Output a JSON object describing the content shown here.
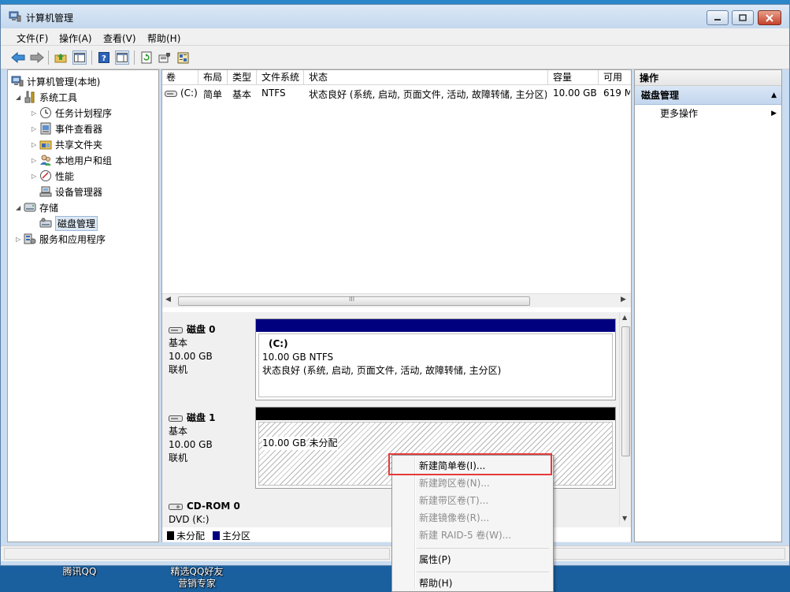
{
  "window": {
    "title": "计算机管理",
    "minimize_glyph": "",
    "close_glyph": "✕"
  },
  "menu": [
    "文件(F)",
    "操作(A)",
    "查看(V)",
    "帮助(H)"
  ],
  "tree": {
    "root": "计算机管理(本地)",
    "system_tools": "系统工具",
    "task_scheduler": "任务计划程序",
    "event_viewer": "事件查看器",
    "shared_folders": "共享文件夹",
    "local_users": "本地用户和组",
    "performance": "性能",
    "device_manager": "设备管理器",
    "storage": "存储",
    "disk_management": "磁盘管理",
    "services_apps": "服务和应用程序"
  },
  "volume_table": {
    "columns": [
      "卷",
      "布局",
      "类型",
      "文件系统",
      "状态",
      "容量",
      "可用空"
    ],
    "rows": [
      [
        "(C:)",
        "简单",
        "基本",
        "NTFS",
        "状态良好 (系统, 启动, 页面文件, 活动, 故障转储, 主分区)",
        "10.00 GB",
        "619 M"
      ]
    ],
    "scroll_glyph": "III"
  },
  "disks": [
    {
      "name": "磁盘 0",
      "type": "基本",
      "size": "10.00 GB",
      "state": "联机",
      "partition": {
        "label": "(C:)",
        "detail": "10.00 GB NTFS",
        "status": "状态良好 (系统, 启动, 页面文件, 活动, 故障转储, 主分区)"
      },
      "bar_color": "#00007f"
    },
    {
      "name": "磁盘 1",
      "type": "基本",
      "size": "10.00 GB",
      "state": "联机",
      "partition": {
        "detail": "10.00 GB",
        "status": "未分配"
      },
      "bar_color": "#000000"
    },
    {
      "name": "CD-ROM 0",
      "type": "DVD (K:)"
    }
  ],
  "legend": [
    {
      "label": "未分配",
      "color": "#000000"
    },
    {
      "label": "主分区",
      "color": "#00007f"
    }
  ],
  "actions": {
    "header": "操作",
    "group": "磁盘管理",
    "more": "更多操作"
  },
  "context_menu": {
    "items": [
      {
        "label": "新建简单卷(I)...",
        "enabled": true
      },
      {
        "label": "新建跨区卷(N)...",
        "enabled": false
      },
      {
        "label": "新建带区卷(T)...",
        "enabled": false
      },
      {
        "label": "新建镜像卷(R)...",
        "enabled": false
      },
      {
        "label": "新建 RAID-5 卷(W)...",
        "enabled": false
      },
      {
        "label": "属性(P)",
        "enabled": true
      },
      {
        "label": "帮助(H)",
        "enabled": true
      }
    ],
    "highlight_color": "#e53b3b"
  },
  "desktop": {
    "icon1": "腾讯QQ",
    "icon2_line1": "精选QQ好友",
    "icon2_line2": "营销专家"
  }
}
